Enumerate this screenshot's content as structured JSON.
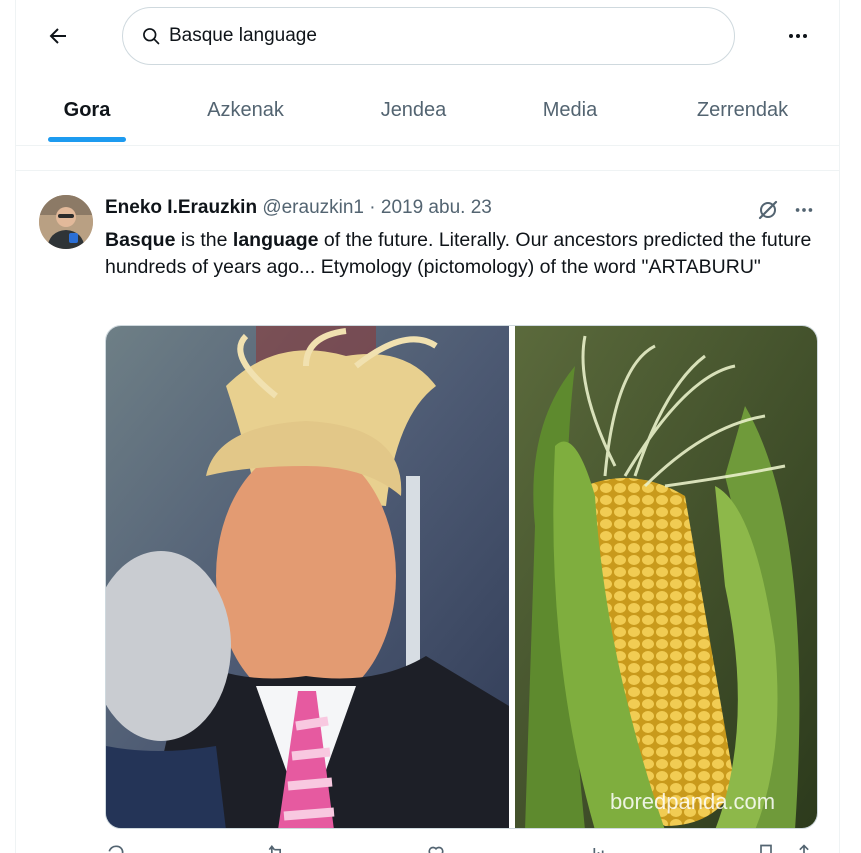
{
  "header": {
    "back_icon": "arrow-left-icon",
    "search": {
      "value": "Basque language",
      "icon": "search-icon"
    },
    "more_icon": "more-horizontal-icon"
  },
  "tabs": [
    {
      "label": "Gora",
      "active": true
    },
    {
      "label": "Azkenak",
      "active": false
    },
    {
      "label": "Jendea",
      "active": false
    },
    {
      "label": "Media",
      "active": false
    },
    {
      "label": "Zerrendak",
      "active": false
    }
  ],
  "tweet": {
    "author": "Eneko I.Erauzkin",
    "handle": "@erauzkin1",
    "separator": "·",
    "date": "2019 abu. 23",
    "text": {
      "w1": "Basque",
      "t1": " is the ",
      "w2": "language",
      "t2": " of the future. Literally. Our ancestors predicted the future hundreds of years ago... Etymology (pictomology) of the word \"ARTABURU\""
    },
    "media_watermark": "boredpanda.com"
  },
  "colors": {
    "accent": "#1d9bf0",
    "secondary_text": "#536471",
    "border": "#eff3f4"
  }
}
